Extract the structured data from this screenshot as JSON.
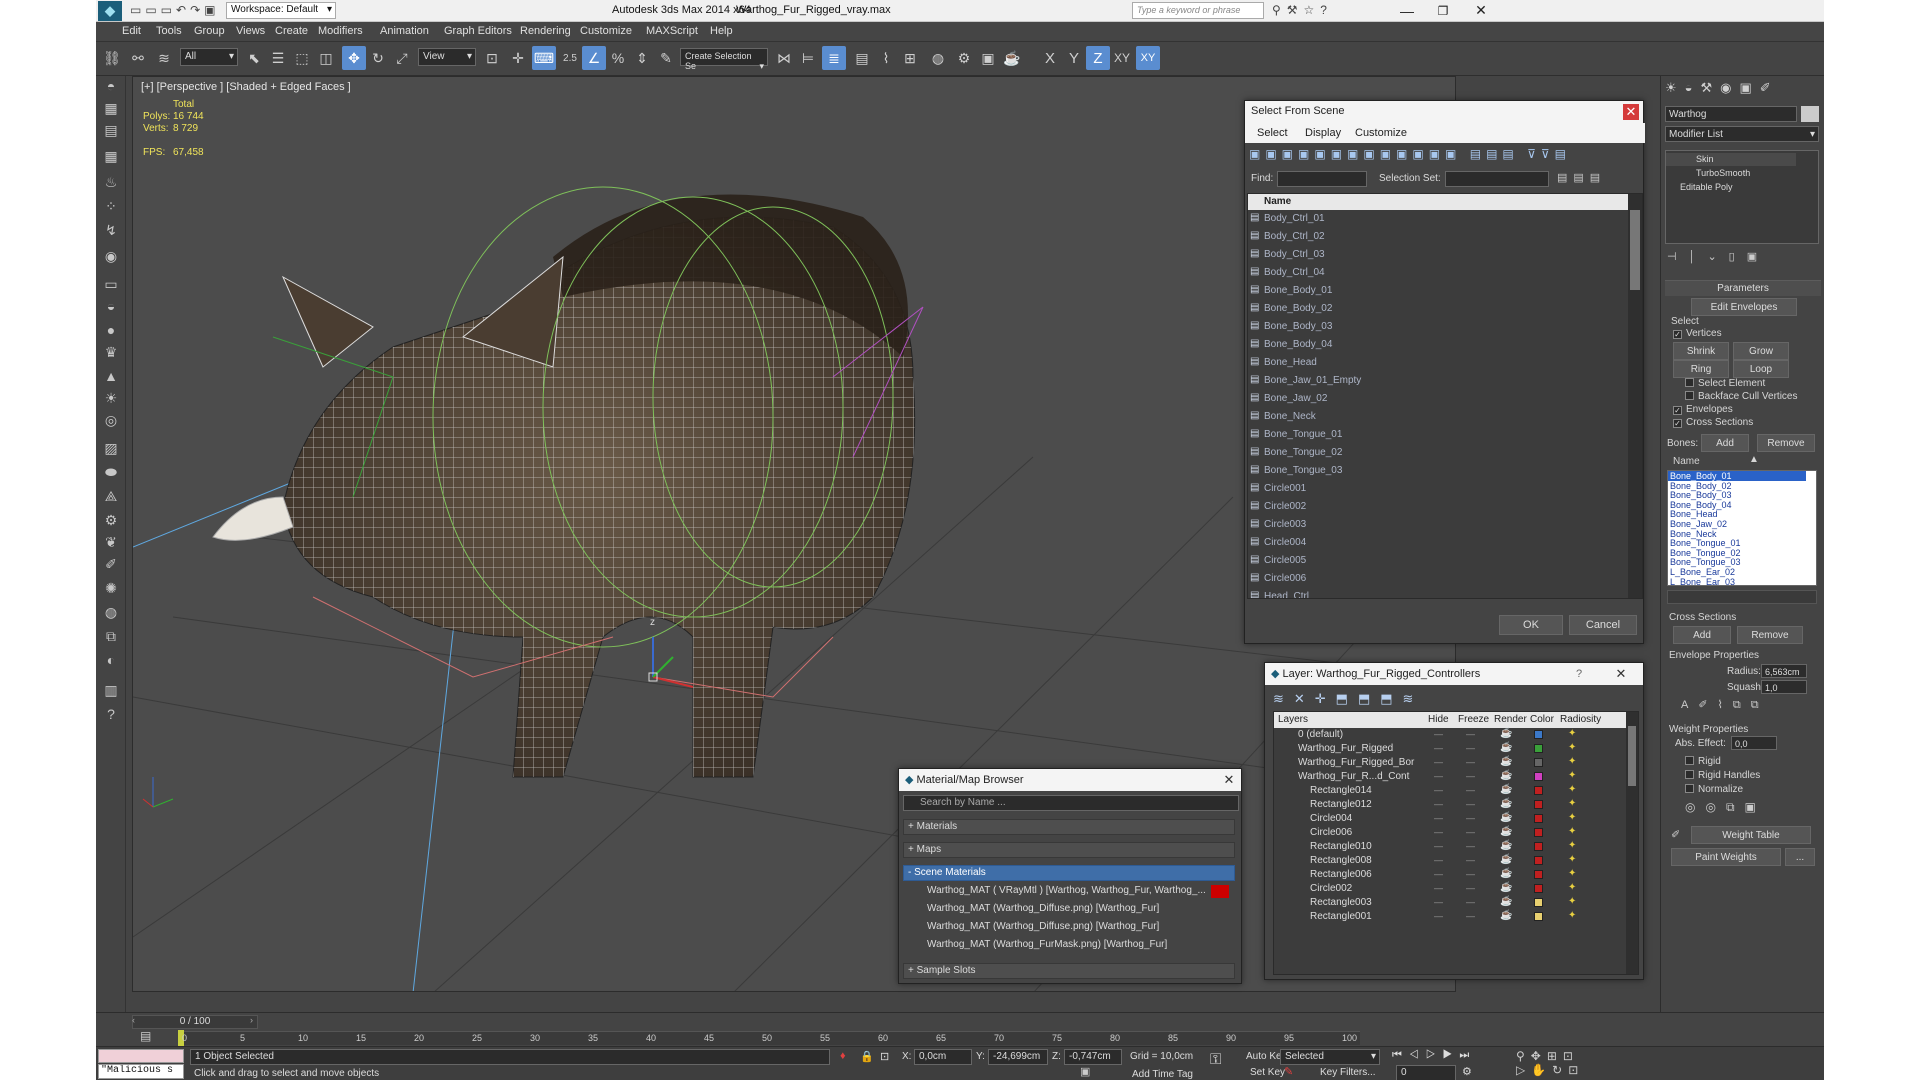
{
  "title_bar": {
    "workspace": "Workspace: Default",
    "app_title": "Autodesk 3ds Max  2014 x64",
    "file_name": "Warthog_Fur_Rigged_vray.max",
    "search_placeholder": "Type a keyword or phrase"
  },
  "menu": [
    "Edit",
    "Tools",
    "Group",
    "Views",
    "Create",
    "Modifiers",
    "Animation",
    "Graph Editors",
    "Rendering",
    "Customize",
    "MAXScript",
    "Help"
  ],
  "toolbar": {
    "selection_filter": "All",
    "ref_coord": "View",
    "snap_label": "2.5",
    "named_selection_placeholder": "Create Selection Se",
    "axis_x": "X",
    "axis_y": "Y",
    "axis_z": "Z",
    "axis_xy": "XY",
    "axis_xy2": "XY"
  },
  "viewport": {
    "label": "[+] [Perspective ] [Shaded + Edged Faces ]",
    "stats": {
      "total": "Total",
      "polys_label": "Polys:",
      "polys": "16 744",
      "verts_label": "Verts:",
      "verts": "8 729",
      "fps_label": "FPS:",
      "fps": "67,458"
    },
    "gizmo_z": "z"
  },
  "select_from_scene": {
    "title": "Select From Scene",
    "menu": [
      "Select",
      "Display",
      "Customize"
    ],
    "find_label": "Find:",
    "selection_set_label": "Selection Set:",
    "column_name": "Name",
    "items": [
      "Body_Ctrl_01",
      "Body_Ctrl_02",
      "Body_Ctrl_03",
      "Body_Ctrl_04",
      "Bone_Body_01",
      "Bone_Body_02",
      "Bone_Body_03",
      "Bone_Body_04",
      "Bone_Head",
      "Bone_Jaw_01_Empty",
      "Bone_Jaw_02",
      "Bone_Neck",
      "Bone_Tongue_01",
      "Bone_Tongue_02",
      "Bone_Tongue_03",
      "Circle001",
      "Circle002",
      "Circle003",
      "Circle004",
      "Circle005",
      "Circle006",
      "Head_Ctrl"
    ],
    "ok": "OK",
    "cancel": "Cancel"
  },
  "material_browser": {
    "title": "Material/Map Browser",
    "search_placeholder": "Search by Name ...",
    "groups": [
      "+ Materials",
      "+ Maps",
      "- Scene Materials"
    ],
    "scene_materials": [
      "Warthog_MAT  ( VRayMtl )  [Warthog, Warthog_Fur, Warthog_...",
      "Warthog_MAT (Warthog_Diffuse.png) [Warthog_Fur]",
      "Warthog_MAT (Warthog_Diffuse.png) [Warthog_Fur]",
      "Warthog_MAT (Warthog_FurMask.png) [Warthog_Fur]"
    ],
    "sample_slots": "+ Sample Slots"
  },
  "layer_dialog": {
    "title": "Layer: Warthog_Fur_Rigged_Controllers",
    "help": "?",
    "columns": [
      "Layers",
      "Hide",
      "Freeze",
      "Render",
      "Color",
      "Radiosity"
    ],
    "rows": [
      {
        "name": "0 (default)",
        "indent": 1,
        "color": "#3b78c8"
      },
      {
        "name": "Warthog_Fur_Rigged",
        "indent": 1,
        "color": "#3aa03a"
      },
      {
        "name": "Warthog_Fur_Rigged_Bor",
        "indent": 1,
        "color": "#666666"
      },
      {
        "name": "Warthog_Fur_R...d_Cont",
        "indent": 1,
        "color": "#d040c0"
      },
      {
        "name": "Rectangle014",
        "indent": 2,
        "color": "#c02020"
      },
      {
        "name": "Rectangle012",
        "indent": 2,
        "color": "#c02020"
      },
      {
        "name": "Circle004",
        "indent": 2,
        "color": "#c02020"
      },
      {
        "name": "Circle006",
        "indent": 2,
        "color": "#c02020"
      },
      {
        "name": "Rectangle010",
        "indent": 2,
        "color": "#c02020"
      },
      {
        "name": "Rectangle008",
        "indent": 2,
        "color": "#c02020"
      },
      {
        "name": "Rectangle006",
        "indent": 2,
        "color": "#c02020"
      },
      {
        "name": "Circle002",
        "indent": 2,
        "color": "#c02020"
      },
      {
        "name": "Rectangle003",
        "indent": 2,
        "color": "#e8d070"
      },
      {
        "name": "Rectangle001",
        "indent": 2,
        "color": "#e8d070"
      }
    ]
  },
  "command_panel": {
    "object_name": "Warthog",
    "modifier_list": "Modifier List",
    "stack": [
      "Skin",
      "TurboSmooth",
      "Editable Poly"
    ],
    "parameters": "Parameters",
    "edit_envelopes": "Edit Envelopes",
    "select_label": "Select",
    "vertices": "Vertices",
    "shrink": "Shrink",
    "grow": "Grow",
    "ring": "Ring",
    "loop": "Loop",
    "select_element": "Select Element",
    "backface": "Backface Cull Vertices",
    "envelopes": "Envelopes",
    "cross_sections": "Cross Sections",
    "bones_label": "Bones:",
    "add": "Add",
    "remove": "Remove",
    "name_label": "Name",
    "bones": [
      "Bone_Body_01",
      "Bone_Body_02",
      "Bone_Body_03",
      "Bone_Body_04",
      "Bone_Head",
      "Bone_Jaw_02",
      "Bone_Neck",
      "Bone_Tongue_01",
      "Bone_Tongue_02",
      "Bone_Tongue_03",
      "L_Bone_Ear_02",
      "L_Bone_Ear_03"
    ],
    "cross_sections_title": "Cross Sections",
    "cs_add": "Add",
    "cs_remove": "Remove",
    "envelope_props": "Envelope Properties",
    "radius_label": "Radius:",
    "radius": "6,563cm",
    "squash_label": "Squash:",
    "squash": "1,0",
    "weight_props": "Weight Properties",
    "abs_effect_label": "Abs. Effect:",
    "abs_effect": "0,0",
    "rigid": "Rigid",
    "rigid_handles": "Rigid Handles",
    "normalize": "Normalize",
    "weight_table": "Weight Table",
    "paint_weights": "Paint Weights",
    "more": "..."
  },
  "timeline": {
    "frame": "0 / 100",
    "ticks": [
      "0",
      "5",
      "10",
      "15",
      "20",
      "25",
      "30",
      "35",
      "40",
      "45",
      "50",
      "55",
      "60",
      "65",
      "70",
      "75",
      "80",
      "85",
      "90",
      "95",
      "100"
    ]
  },
  "status": {
    "maxscript": "\"Malicious s",
    "selected": "1 Object Selected",
    "prompt": "Click and drag to select and move objects",
    "x_label": "X:",
    "x": "0,0cm",
    "y_label": "Y:",
    "y": "-24,699cm",
    "z_label": "Z:",
    "z": "-0,747cm",
    "grid": "Grid = 10,0cm",
    "add_time_tag": "Add Time Tag",
    "auto_key": "Auto Key",
    "set_key": "Set Key",
    "selected_dropdown": "Selected",
    "key_filters": "Key Filters...",
    "frame_field": "0"
  }
}
